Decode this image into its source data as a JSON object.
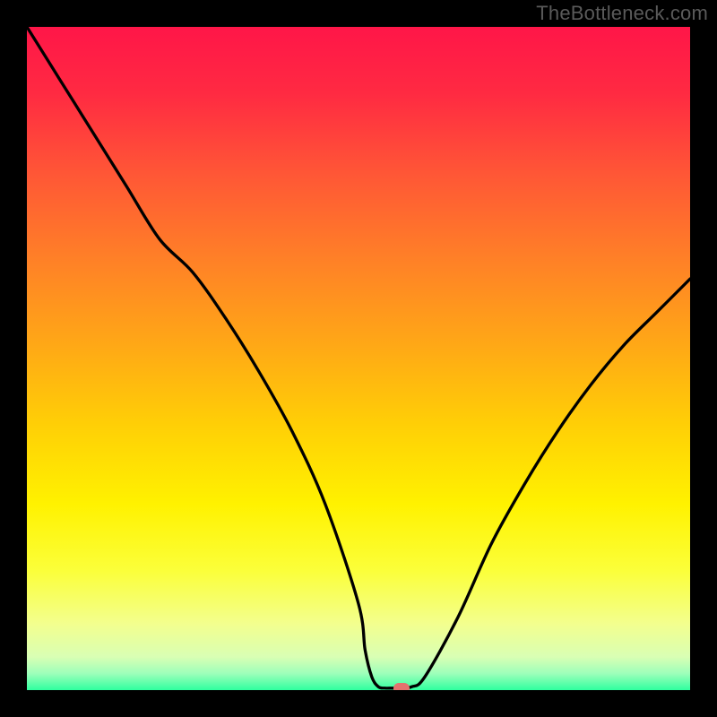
{
  "watermark": {
    "text": "TheBottleneck.com"
  },
  "gradient": {
    "stops": [
      {
        "offset": 0.0,
        "color": "#ff1648"
      },
      {
        "offset": 0.1,
        "color": "#ff2a42"
      },
      {
        "offset": 0.22,
        "color": "#ff5636"
      },
      {
        "offset": 0.35,
        "color": "#ff8027"
      },
      {
        "offset": 0.48,
        "color": "#ffa816"
      },
      {
        "offset": 0.6,
        "color": "#ffcf06"
      },
      {
        "offset": 0.72,
        "color": "#fff200"
      },
      {
        "offset": 0.82,
        "color": "#fbff3a"
      },
      {
        "offset": 0.9,
        "color": "#f3ff8e"
      },
      {
        "offset": 0.95,
        "color": "#d9ffb4"
      },
      {
        "offset": 0.975,
        "color": "#9dffba"
      },
      {
        "offset": 1.0,
        "color": "#2fff9f"
      }
    ]
  },
  "chart_data": {
    "type": "line",
    "title": "",
    "xlabel": "",
    "ylabel": "",
    "xlim": [
      0,
      100
    ],
    "ylim": [
      0,
      100
    ],
    "grid": false,
    "series": [
      {
        "name": "bottleneck-curve",
        "x": [
          0,
          5,
          10,
          15,
          20,
          25,
          30,
          35,
          40,
          45,
          50,
          51,
          52,
          53,
          54,
          55,
          56,
          58,
          60,
          65,
          70,
          75,
          80,
          85,
          90,
          95,
          100
        ],
        "y": [
          100,
          92,
          84,
          76,
          68,
          63,
          56,
          48,
          39,
          28,
          13,
          6,
          2,
          0.5,
          0.3,
          0.3,
          0.3,
          0.5,
          2,
          11,
          22,
          31,
          39,
          46,
          52,
          57,
          62
        ]
      }
    ],
    "annotations": [
      {
        "name": "optimal-marker",
        "x": 56.5,
        "y": 0.3,
        "color": "#e4716e"
      }
    ]
  }
}
